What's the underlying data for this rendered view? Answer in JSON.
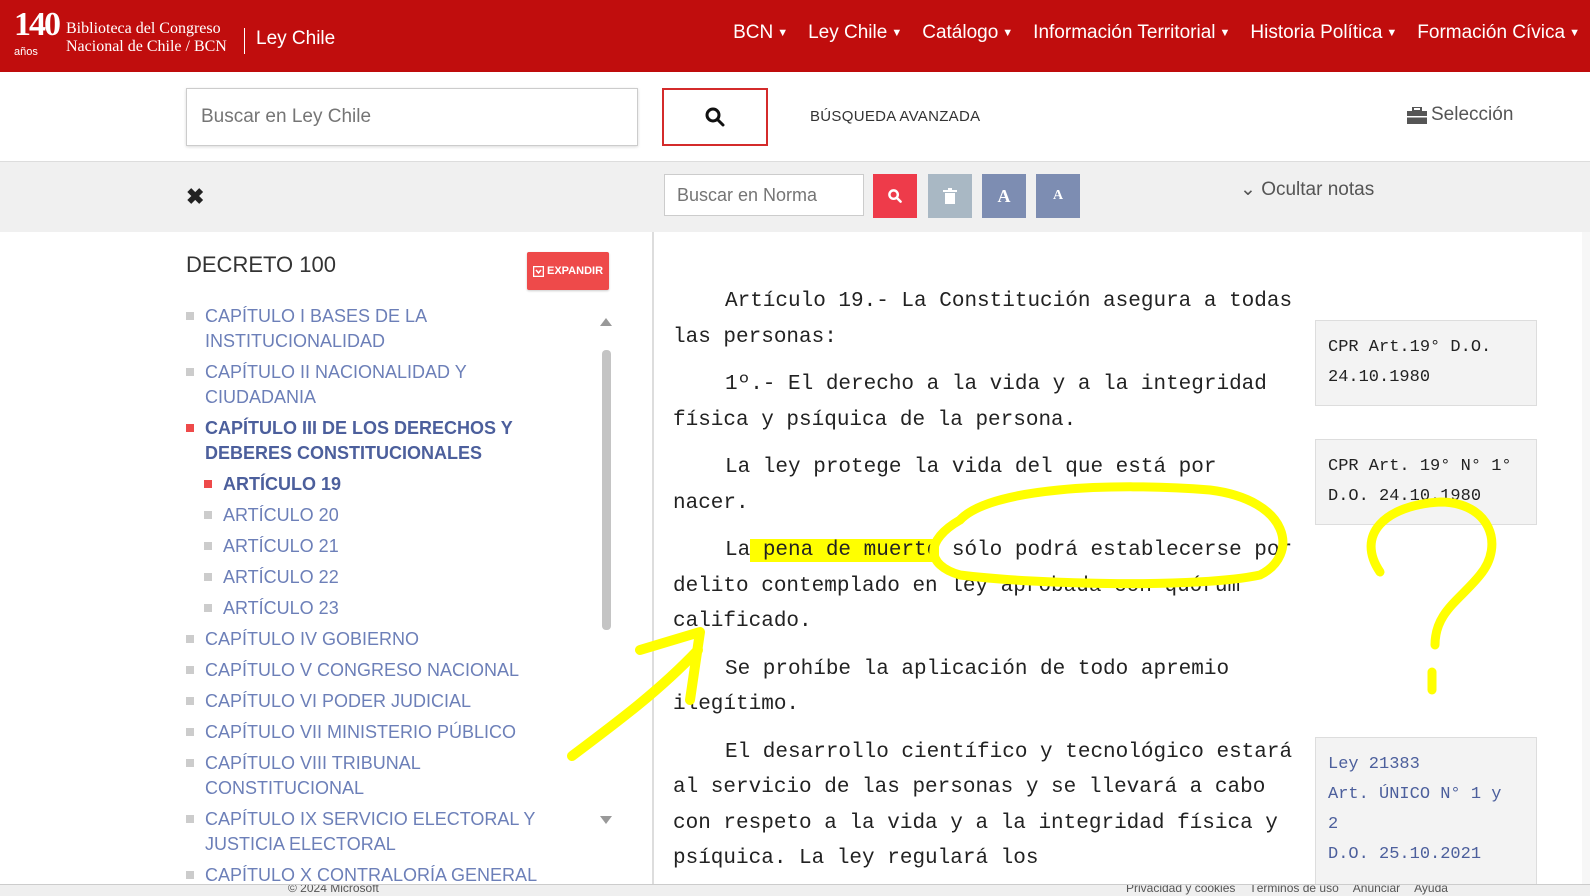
{
  "header": {
    "logo_number": "140",
    "logo_anos": "años",
    "org_line1": "Biblioteca del Congreso",
    "org_line2": "Nacional de Chile / BCN",
    "site_name": "Ley Chile",
    "nav": [
      "BCN",
      "Ley Chile",
      "Catálogo",
      "Información Territorial",
      "Historia Política",
      "Formación Cívica"
    ]
  },
  "search": {
    "placeholder": "Buscar en Ley Chile",
    "advanced_label": "BÚSQUEDA AVANZADA",
    "selection_label": "Selección"
  },
  "tools": {
    "norm_placeholder": "Buscar en Norma",
    "font_up": "A",
    "font_down": "A",
    "hide_notes": "Ocultar notas"
  },
  "sidebar": {
    "title": "DECRETO 100",
    "expand_label": "EXPANDIR",
    "toc": [
      {
        "label": "CAPÍTULO I BASES DE LA INSTITUCIONALIDAD",
        "level": 0,
        "active": false
      },
      {
        "label": "CAPÍTULO II NACIONALIDAD Y CIUDADANIA",
        "level": 0,
        "active": false
      },
      {
        "label": "CAPÍTULO III DE LOS DERECHOS Y DEBERES CONSTITUCIONALES",
        "level": 0,
        "active": true
      },
      {
        "label": "ARTÍCULO 19",
        "level": 1,
        "active": true
      },
      {
        "label": "ARTÍCULO 20",
        "level": 1,
        "active": false
      },
      {
        "label": "ARTÍCULO 21",
        "level": 1,
        "active": false
      },
      {
        "label": "ARTÍCULO 22",
        "level": 1,
        "active": false
      },
      {
        "label": "ARTÍCULO 23",
        "level": 1,
        "active": false
      },
      {
        "label": "CAPÍTULO IV GOBIERNO",
        "level": 0,
        "active": false
      },
      {
        "label": "CAPÍTULO V CONGRESO NACIONAL",
        "level": 0,
        "active": false
      },
      {
        "label": "CAPÍTULO VI PODER JUDICIAL",
        "level": 0,
        "active": false
      },
      {
        "label": "CAPÍTULO VII MINISTERIO PÚBLICO",
        "level": 0,
        "active": false
      },
      {
        "label": "CAPÍTULO VIII TRIBUNAL CONSTITUCIONAL",
        "level": 0,
        "active": false
      },
      {
        "label": "CAPÍTULO IX SERVICIO ELECTORAL Y JUSTICIA ELECTORAL",
        "level": 0,
        "active": false
      },
      {
        "label": "CAPÍTULO X CONTRALORÍA GENERAL DE LA REPÚBLICA",
        "level": 0,
        "active": false
      }
    ]
  },
  "content": {
    "p1": "Artículo 19.- La Constitución asegura a todas las personas:",
    "p2": "1º.- El derecho a la vida y a la integridad física y psíquica de la persona.",
    "p3": "La ley protege la vida del que está por nacer.",
    "p4_a": "La",
    "p4_hl": " pena de muerte",
    "p4_b": " sólo podrá establecerse por delito contemplado en ley aprobada con quórum calificado.",
    "p5": "Se prohíbe la aplicación de todo apremio ilegítimo.",
    "p6": "El desarrollo científico y tecnológico estará al servicio de las personas y se llevará a cabo con respeto a la vida y a la integridad física y psíquica. La ley regulará los",
    "notes": [
      {
        "l1": "CPR Art.19° D.O.",
        "l2": "24.10.1980"
      },
      {
        "l1": "CPR Art. 19° N° 1°",
        "l2": "D.O. 24.10.1980"
      },
      {
        "l1": "Ley 21383",
        "l2": "Art. ÚNICO N° 1 y",
        "l3": "2",
        "l4": "D.O. 25.10.2021"
      }
    ]
  },
  "footer": {
    "left": "© 2024 Microsoft",
    "right": [
      "Privacidad y cookies",
      "Términos de uso",
      "Anunciar",
      "Ayuda"
    ]
  },
  "colors": {
    "brand_red": "#c00d0d",
    "link_blue": "#6c7fb8",
    "highlight_yellow": "#ffff00"
  }
}
